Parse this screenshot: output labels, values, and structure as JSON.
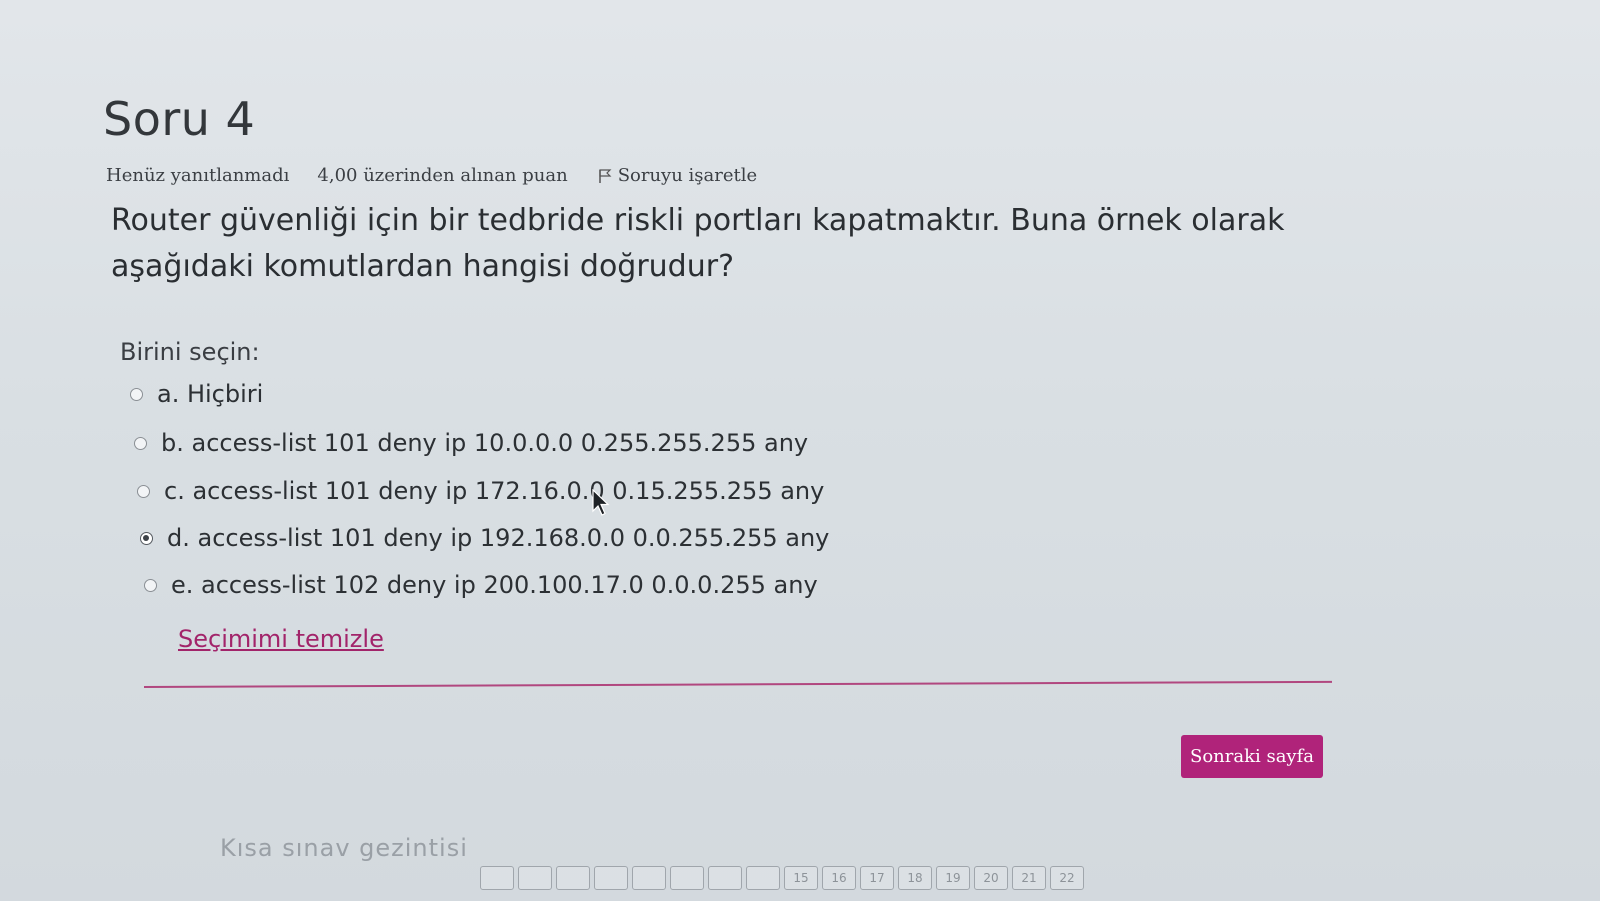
{
  "question": {
    "title": "Soru 4",
    "status": "Henüz yanıtlanmadı",
    "points": "4,00 üzerinden alınan puan",
    "flag_label": "Soruyu işaretle",
    "text": "Router güvenliği için bir tedbride riskli portları kapatmaktır. Buna örnek olarak aşağıdaki komutlardan hangisi doğrudur?",
    "prompt": "Birini seçin:"
  },
  "options": [
    {
      "label": "a. Hiçbiri",
      "selected": false
    },
    {
      "label": "b. access-list 101 deny ip 10.0.0.0 0.255.255.255 any",
      "selected": false
    },
    {
      "label": "c. access-list 101 deny ip 172.16.0.0 0.15.255.255 any",
      "selected": false
    },
    {
      "label": "d. access-list 101 deny ip 192.168.0.0 0.0.255.255 any",
      "selected": true
    },
    {
      "label": "e. access-list 102 deny ip 200.100.17.0 0.0.0.255 any",
      "selected": false
    }
  ],
  "clear_label": "Seçimimi temizle",
  "next_button": "Sonraki sayfa",
  "navigation": {
    "title": "Kısa sınav gezintisi",
    "pages": [
      "",
      "",
      "",
      "",
      "",
      "",
      "",
      "",
      "15",
      "16",
      "17",
      "18",
      "19",
      "20",
      "21",
      "22"
    ]
  },
  "colors": {
    "accent": "#b0237a",
    "link": "#a2246a"
  }
}
